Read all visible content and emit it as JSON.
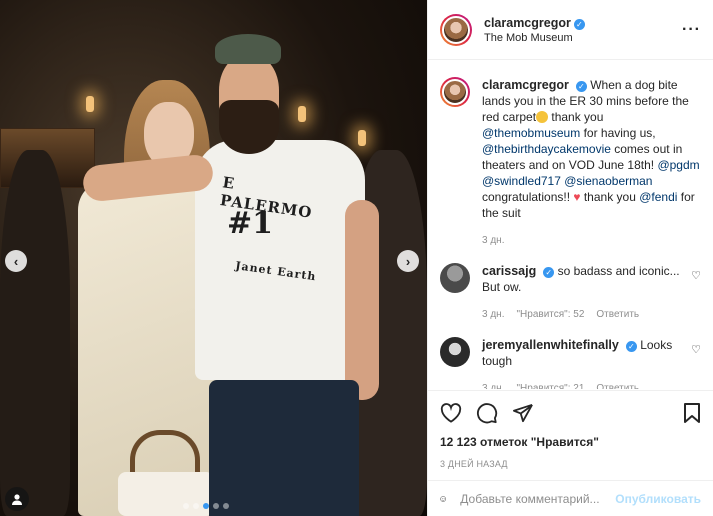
{
  "header": {
    "username": "claramcgregor",
    "location": "The Mob Museum",
    "more_icon": "more-horizontal-icon"
  },
  "photo": {
    "shirt_line1": "E PALERMO",
    "shirt_num": "#1",
    "shirt_line2": "Janet Earth",
    "prev_icon": "chevron-left-icon",
    "next_icon": "chevron-right-icon",
    "tag_icon": "user-tag-icon",
    "slide_count": 5,
    "active_slide": 2
  },
  "caption": {
    "username": "claramcgregor",
    "text1": "When a dog bite lands you in the ER 30 mins before the red carpet",
    "text2": " thank you ",
    "mention1": "@themobmuseum",
    "text3": " for having us, ",
    "mention2": "@thebirthdaycakemovie",
    "text4": " comes out in theaters and on VOD June 18th! ",
    "mention3": "@pgdm",
    "mention4": "@swindled717",
    "mention5": "@sienaoberman",
    "text5": " congratulations!! ",
    "text6": " thank you ",
    "mention6": "@fendi",
    "text7": " for the suit",
    "time": "3 дн."
  },
  "comments": [
    {
      "username": "carissajg",
      "text": "so badass and iconic... But ow.",
      "time": "3 дн.",
      "likes": "\"Нравится\": 52",
      "reply": "Ответить"
    },
    {
      "username": "jeremyallenwhitefinally",
      "text": "Looks tough",
      "time": "3 дн.",
      "likes": "\"Нравится\": 21",
      "reply": "Ответить"
    }
  ],
  "actions": {
    "likes_text": "12 123 отметок \"Нравится\"",
    "date": "3 ДНЕЙ НАЗАД"
  },
  "add_comment": {
    "placeholder": "Добавьте комментарий...",
    "publish": "Опубликовать"
  },
  "colors": {
    "link": "#00376b",
    "verified": "#3897f0",
    "publish_disabled": "#b2dffc",
    "heart_red": "#ed4956"
  }
}
